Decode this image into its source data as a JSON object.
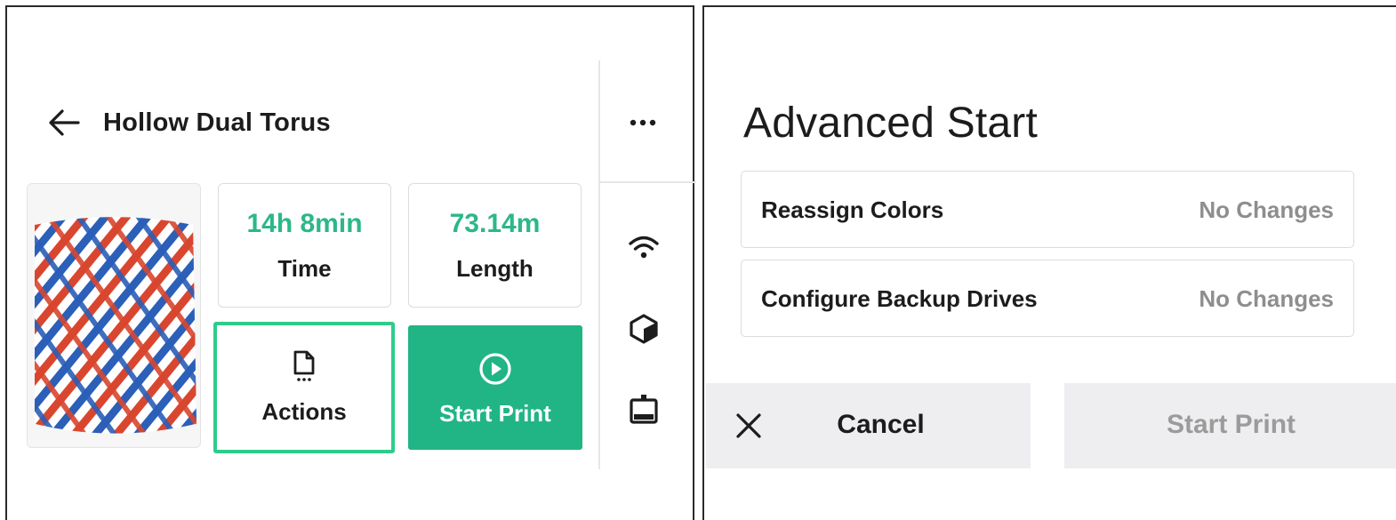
{
  "job": {
    "title": "Hollow Dual Torus",
    "stats": {
      "time_value": "14h 8min",
      "time_label": "Time",
      "length_value": "73.14m",
      "length_label": "Length"
    },
    "actions_label": "Actions",
    "start_print_label": "Start Print"
  },
  "icons": {
    "back": "arrow-left-icon",
    "more": "more-horizontal-icon",
    "wifi": "wifi-icon",
    "material": "cube-icon",
    "drive": "drive-icon",
    "file": "file-icon",
    "play": "play-circle-icon",
    "close": "close-icon"
  },
  "colors": {
    "accent": "#21b585",
    "accent_text": "#2bb886",
    "selected_border": "#2ecc8a",
    "muted_text": "#8e8e8e",
    "button_bg": "#eeeef1"
  },
  "advanced": {
    "title": "Advanced Start",
    "options": [
      {
        "label": "Reassign Colors",
        "value": "No Changes"
      },
      {
        "label": "Configure Backup Drives",
        "value": "No Changes"
      }
    ],
    "cancel_label": "Cancel",
    "start_print_label": "Start Print"
  }
}
